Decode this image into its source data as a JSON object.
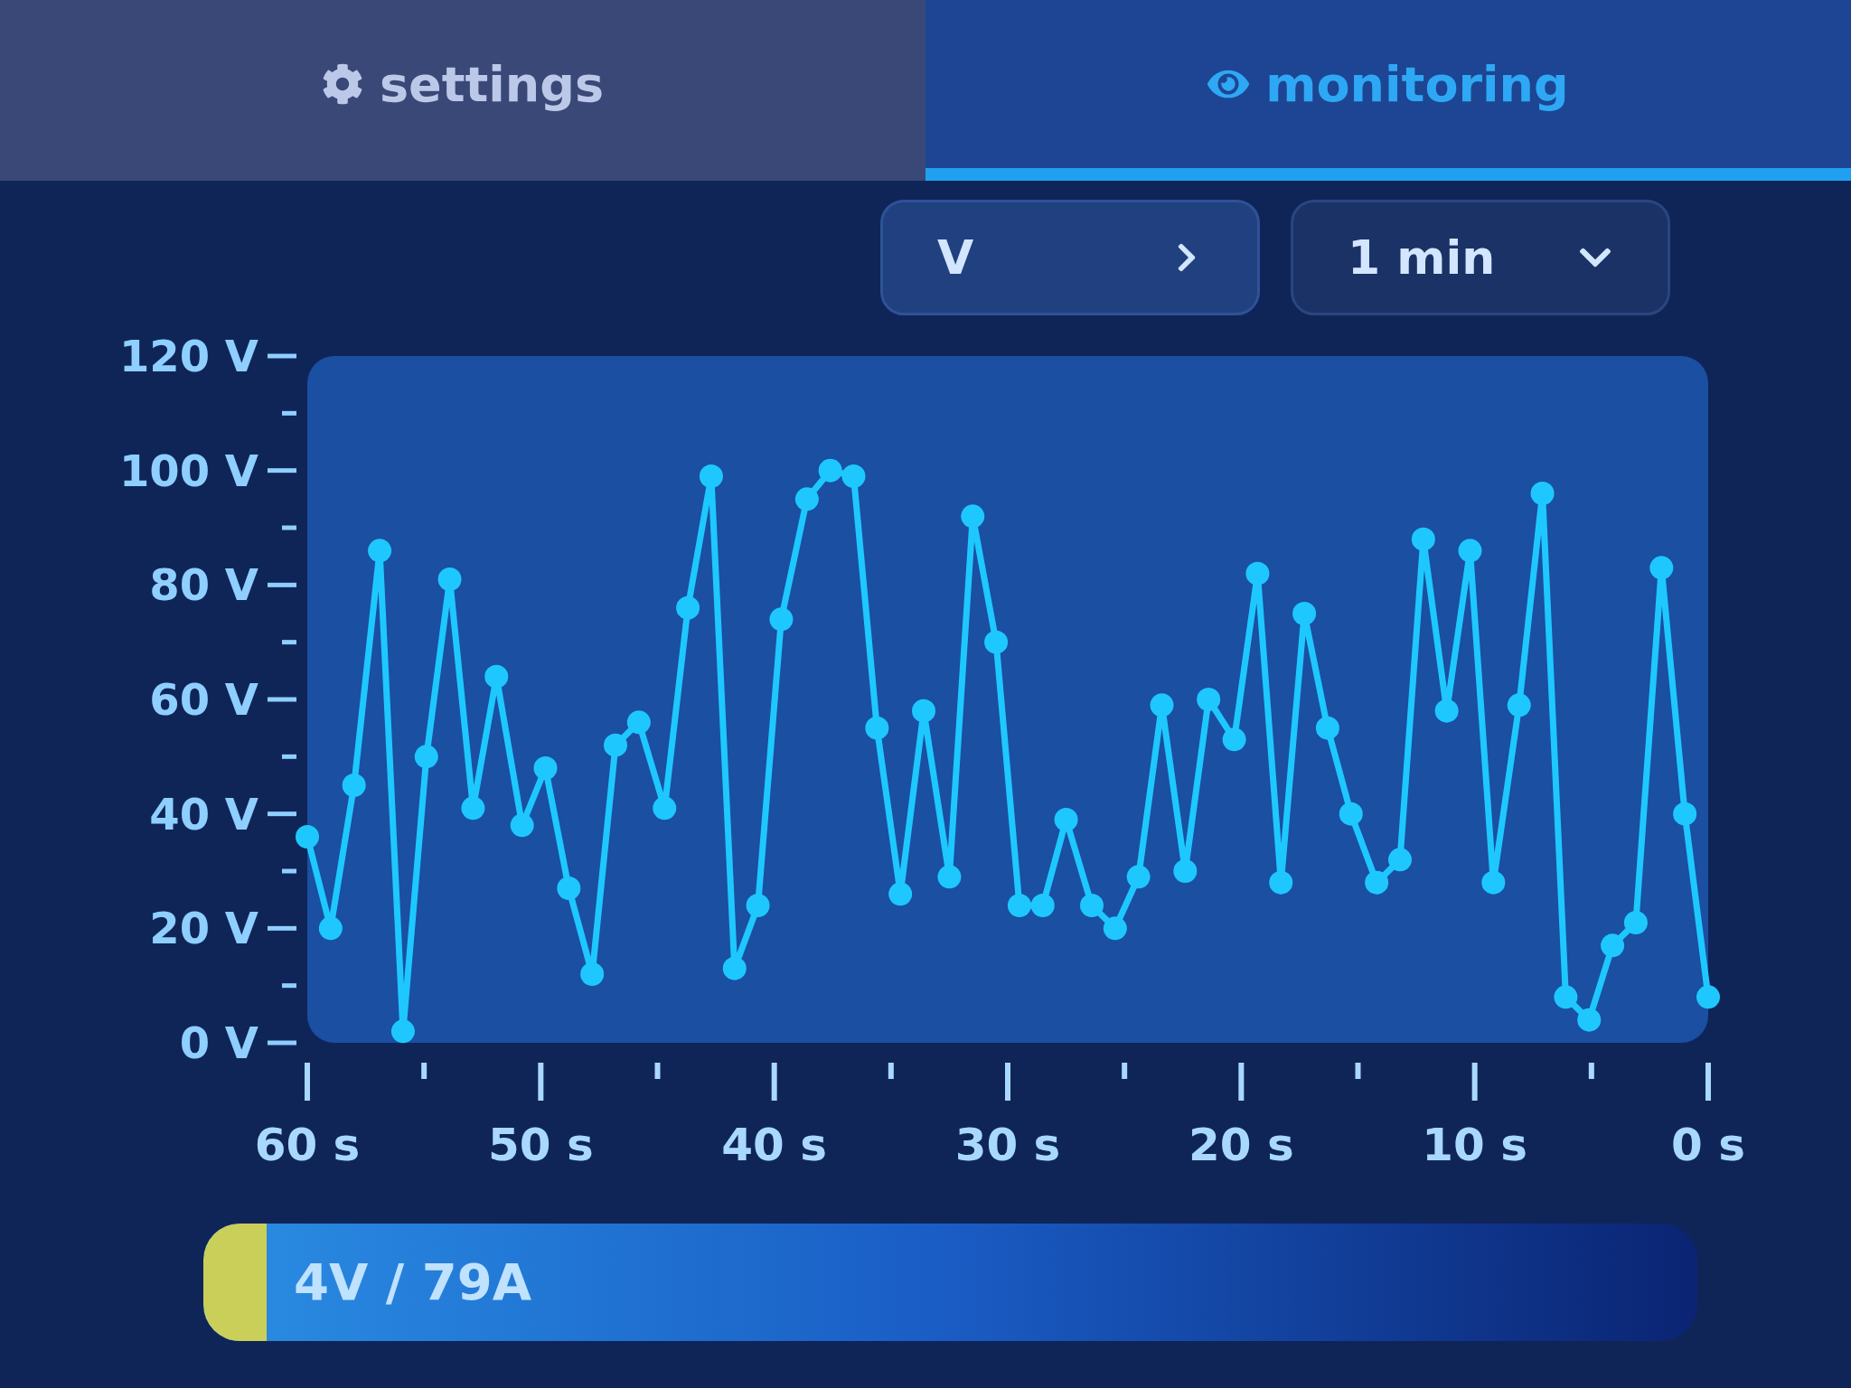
{
  "tabs": [
    {
      "label": "settings",
      "selected": false
    },
    {
      "label": "monitoring",
      "selected": true
    }
  ],
  "selectors": [
    {
      "kind": "cycle",
      "value": "V"
    },
    {
      "kind": "dropdown",
      "value": "1 min"
    }
  ],
  "chart": {
    "chart_data": {
      "type": "line",
      "x": [
        60,
        59,
        58,
        56.9,
        55.9,
        54.9,
        53.9,
        52.9,
        51.9,
        50.8,
        49.8,
        48.8,
        47.8,
        46.8,
        45.8,
        44.7,
        43.7,
        42.7,
        41.7,
        40.7,
        39.7,
        38.6,
        37.6,
        36.6,
        35.6,
        34.6,
        33.6,
        32.5,
        31.5,
        30.5,
        29.5,
        28.5,
        27.5,
        26.4,
        25.4,
        24.4,
        23.4,
        22.4,
        21.4,
        20.3,
        19.3,
        18.3,
        17.3,
        16.3,
        15.3,
        14.2,
        13.2,
        12.2,
        11.2,
        10.2,
        9.2,
        8.1,
        7.1,
        6.1,
        5.1,
        4.1,
        3.1,
        2,
        1,
        0
      ],
      "xlim": [
        60,
        0
      ],
      "ylim": [
        0,
        120
      ],
      "xticks": [
        {
          "value": 60,
          "label": "60 s"
        },
        {
          "value": 50,
          "label": "50 s"
        },
        {
          "value": 40,
          "label": "40 s"
        },
        {
          "value": 30,
          "label": "30 s"
        },
        {
          "value": 20,
          "label": "20 s"
        },
        {
          "value": 10,
          "label": "10 s"
        },
        {
          "value": 0,
          "label": "0 s"
        }
      ],
      "yticks": [
        {
          "value": 120,
          "label": "120 V"
        },
        {
          "value": 100,
          "label": "100 V"
        },
        {
          "value": 80,
          "label": "80 V"
        },
        {
          "value": 60,
          "label": "60 V"
        },
        {
          "value": 40,
          "label": "40 V"
        },
        {
          "value": 20,
          "label": "20 V"
        },
        {
          "value": 0,
          "label": "0 V"
        }
      ],
      "series": [
        {
          "color": "#1ec8ff",
          "marker": "circle",
          "values": [
            36,
            20,
            45,
            86,
            2,
            50,
            81,
            41,
            64,
            38,
            48,
            27,
            12,
            52,
            56,
            41,
            76,
            99,
            13,
            24,
            74,
            95,
            100,
            99,
            55,
            26,
            58,
            29,
            92,
            70,
            24,
            24,
            39,
            24,
            20,
            29,
            59,
            30,
            60,
            53,
            82,
            28,
            75,
            55,
            40,
            28,
            32,
            88,
            58,
            86,
            28,
            59,
            96,
            8,
            4,
            17,
            21,
            83,
            40,
            8
          ]
        }
      ]
    }
  },
  "status_bar": {
    "text": "4V / 79A"
  }
}
